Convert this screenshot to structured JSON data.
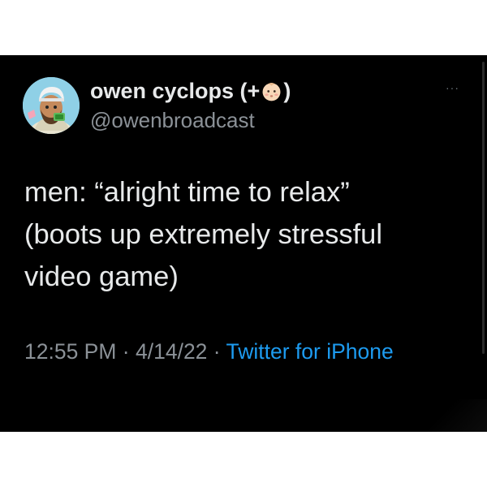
{
  "user": {
    "display_name_prefix": "owen cyclops (+",
    "display_name_suffix": ")",
    "handle": "@owenbroadcast",
    "avatar_icon": "cartoon-man-avatar",
    "name_emoji": "baby-face-emoji"
  },
  "tweet": {
    "text": "men: “alright time to relax”\n(boots up extremely stressful\nvideo game)"
  },
  "meta": {
    "time": "12:55 PM",
    "separator1": " · ",
    "date": "4/14/22",
    "separator2": " · ",
    "source": "Twitter for iPhone"
  },
  "more_menu": {
    "label": "···"
  },
  "colors": {
    "background": "#000000",
    "text": "#e7e9ea",
    "secondary": "#8b9197",
    "link": "#1d9bf0"
  }
}
